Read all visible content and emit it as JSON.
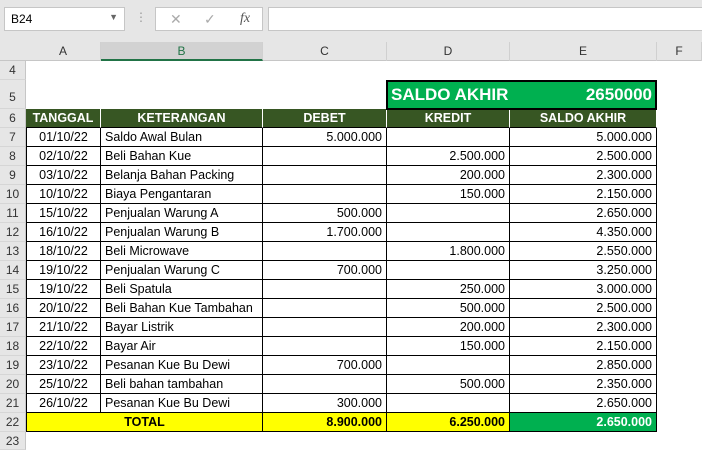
{
  "formula_bar": {
    "name_box": "B24",
    "cancel_icon": "✕",
    "enter_icon": "✓",
    "fx_label": "fx",
    "formula": ""
  },
  "columns": [
    "A",
    "B",
    "C",
    "D",
    "E",
    "F"
  ],
  "selected_column": "B",
  "row_numbers": [
    "4",
    "5",
    "6",
    "7",
    "8",
    "9",
    "10",
    "11",
    "12",
    "13",
    "14",
    "15",
    "16",
    "17",
    "18",
    "19",
    "20",
    "21",
    "22",
    "23"
  ],
  "summary": {
    "label": "SALDO AKHIR",
    "value": "2650000"
  },
  "headers": [
    "TANGGAL",
    "KETERANGAN",
    "DEBET",
    "KREDIT",
    "SALDO AKHIR"
  ],
  "rows": [
    [
      "01/10/22",
      "Saldo Awal Bulan",
      "5.000.000",
      "",
      "5.000.000"
    ],
    [
      "02/10/22",
      "Beli Bahan Kue",
      "",
      "2.500.000",
      "2.500.000"
    ],
    [
      "03/10/22",
      "Belanja Bahan Packing",
      "",
      "200.000",
      "2.300.000"
    ],
    [
      "10/10/22",
      "Biaya Pengantaran",
      "",
      "150.000",
      "2.150.000"
    ],
    [
      "15/10/22",
      "Penjualan Warung A",
      "500.000",
      "",
      "2.650.000"
    ],
    [
      "16/10/22",
      "Penjualan Warung B",
      "1.700.000",
      "",
      "4.350.000"
    ],
    [
      "18/10/22",
      "Beli Microwave",
      "",
      "1.800.000",
      "2.550.000"
    ],
    [
      "19/10/22",
      "Penjualan Warung C",
      "700.000",
      "",
      "3.250.000"
    ],
    [
      "19/10/22",
      "Beli Spatula",
      "",
      "250.000",
      "3.000.000"
    ],
    [
      "20/10/22",
      "Beli Bahan Kue Tambahan",
      "",
      "500.000",
      "2.500.000"
    ],
    [
      "21/10/22",
      "Bayar Listrik",
      "",
      "200.000",
      "2.300.000"
    ],
    [
      "22/10/22",
      "Bayar Air",
      "",
      "150.000",
      "2.150.000"
    ],
    [
      "23/10/22",
      "Pesanan Kue Bu Dewi",
      "700.000",
      "",
      "2.850.000"
    ],
    [
      "25/10/22",
      "Beli bahan tambahan",
      "",
      "500.000",
      "2.350.000"
    ],
    [
      "26/10/22",
      "Pesanan Kue Bu Dewi",
      "300.000",
      "",
      "2.650.000"
    ]
  ],
  "total": {
    "label": "TOTAL",
    "debet": "8.900.000",
    "kredit": "6.250.000",
    "saldo": "2.650.000"
  },
  "colors": {
    "header_bg": "#375623",
    "summary_bg": "#00b050",
    "total_bg": "#ffff00"
  }
}
